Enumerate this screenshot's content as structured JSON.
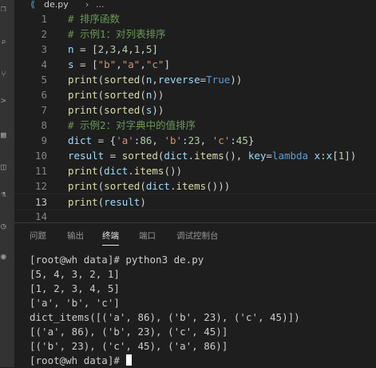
{
  "breadcrumb": {
    "file_icon": "python-file-icon",
    "file_name": "de.py",
    "separator": "›",
    "more": "..."
  },
  "editor": {
    "lines": [
      {
        "number": "1",
        "tokens": [
          {
            "t": "# 排序函数",
            "c": "comment"
          }
        ]
      },
      {
        "number": "2",
        "tokens": [
          {
            "t": "# 示例1：对列表排序",
            "c": "comment"
          }
        ]
      },
      {
        "number": "3",
        "tokens": [
          {
            "t": "n",
            "c": "var"
          },
          {
            "t": " = [",
            "c": "plain"
          },
          {
            "t": "2",
            "c": "number"
          },
          {
            "t": ",",
            "c": "plain"
          },
          {
            "t": "3",
            "c": "number"
          },
          {
            "t": ",",
            "c": "plain"
          },
          {
            "t": "4",
            "c": "number"
          },
          {
            "t": ",",
            "c": "plain"
          },
          {
            "t": "1",
            "c": "number"
          },
          {
            "t": ",",
            "c": "plain"
          },
          {
            "t": "5",
            "c": "number"
          },
          {
            "t": "]",
            "c": "plain"
          }
        ]
      },
      {
        "number": "4",
        "tokens": [
          {
            "t": "s",
            "c": "var"
          },
          {
            "t": " = [",
            "c": "plain"
          },
          {
            "t": "\"b\"",
            "c": "string"
          },
          {
            "t": ",",
            "c": "plain"
          },
          {
            "t": "\"a\"",
            "c": "string"
          },
          {
            "t": ",",
            "c": "plain"
          },
          {
            "t": "\"c\"",
            "c": "string"
          },
          {
            "t": "]",
            "c": "plain"
          }
        ]
      },
      {
        "number": "5",
        "tokens": [
          {
            "t": "print",
            "c": "func"
          },
          {
            "t": "(",
            "c": "plain"
          },
          {
            "t": "sorted",
            "c": "func"
          },
          {
            "t": "(",
            "c": "plain"
          },
          {
            "t": "n",
            "c": "var"
          },
          {
            "t": ",",
            "c": "plain"
          },
          {
            "t": "reverse",
            "c": "var"
          },
          {
            "t": "=",
            "c": "plain"
          },
          {
            "t": "True",
            "c": "kw"
          },
          {
            "t": "))",
            "c": "plain"
          }
        ]
      },
      {
        "number": "6",
        "tokens": [
          {
            "t": "print",
            "c": "func"
          },
          {
            "t": "(",
            "c": "plain"
          },
          {
            "t": "sorted",
            "c": "func"
          },
          {
            "t": "(",
            "c": "plain"
          },
          {
            "t": "n",
            "c": "var"
          },
          {
            "t": "))",
            "c": "plain"
          }
        ]
      },
      {
        "number": "7",
        "tokens": [
          {
            "t": "print",
            "c": "func"
          },
          {
            "t": "(",
            "c": "plain"
          },
          {
            "t": "sorted",
            "c": "func"
          },
          {
            "t": "(",
            "c": "plain"
          },
          {
            "t": "s",
            "c": "var"
          },
          {
            "t": "))",
            "c": "plain"
          }
        ]
      },
      {
        "number": "8",
        "tokens": [
          {
            "t": "# 示例2：对字典中的值排序",
            "c": "comment"
          }
        ]
      },
      {
        "number": "9",
        "tokens": [
          {
            "t": "dict",
            "c": "var"
          },
          {
            "t": " = {",
            "c": "plain"
          },
          {
            "t": "'a'",
            "c": "string"
          },
          {
            "t": ":",
            "c": "plain"
          },
          {
            "t": "86",
            "c": "number"
          },
          {
            "t": ", ",
            "c": "plain"
          },
          {
            "t": "'b'",
            "c": "string"
          },
          {
            "t": ":",
            "c": "plain"
          },
          {
            "t": "23",
            "c": "number"
          },
          {
            "t": ", ",
            "c": "plain"
          },
          {
            "t": "'c'",
            "c": "string"
          },
          {
            "t": ":",
            "c": "plain"
          },
          {
            "t": "45",
            "c": "number"
          },
          {
            "t": "}",
            "c": "plain"
          }
        ]
      },
      {
        "number": "10",
        "tokens": [
          {
            "t": "result",
            "c": "var"
          },
          {
            "t": " = ",
            "c": "plain"
          },
          {
            "t": "sorted",
            "c": "func"
          },
          {
            "t": "(",
            "c": "plain"
          },
          {
            "t": "dict",
            "c": "var"
          },
          {
            "t": ".",
            "c": "plain"
          },
          {
            "t": "items",
            "c": "func"
          },
          {
            "t": "(), ",
            "c": "plain"
          },
          {
            "t": "key",
            "c": "var"
          },
          {
            "t": "=",
            "c": "plain"
          },
          {
            "t": "lambda",
            "c": "kw"
          },
          {
            "t": " ",
            "c": "plain"
          },
          {
            "t": "x",
            "c": "var"
          },
          {
            "t": ":",
            "c": "plain"
          },
          {
            "t": "x",
            "c": "var"
          },
          {
            "t": "[",
            "c": "plain"
          },
          {
            "t": "1",
            "c": "number"
          },
          {
            "t": "])",
            "c": "plain"
          }
        ]
      },
      {
        "number": "11",
        "tokens": [
          {
            "t": "print",
            "c": "func"
          },
          {
            "t": "(",
            "c": "plain"
          },
          {
            "t": "dict",
            "c": "var"
          },
          {
            "t": ".",
            "c": "plain"
          },
          {
            "t": "items",
            "c": "func"
          },
          {
            "t": "())",
            "c": "plain"
          }
        ]
      },
      {
        "number": "12",
        "tokens": [
          {
            "t": "print",
            "c": "func"
          },
          {
            "t": "(",
            "c": "plain"
          },
          {
            "t": "sorted",
            "c": "func"
          },
          {
            "t": "(",
            "c": "plain"
          },
          {
            "t": "dict",
            "c": "var"
          },
          {
            "t": ".",
            "c": "plain"
          },
          {
            "t": "items",
            "c": "func"
          },
          {
            "t": "()))",
            "c": "plain"
          }
        ]
      },
      {
        "number": "13",
        "current": true,
        "tokens": [
          {
            "t": "print",
            "c": "func"
          },
          {
            "t": "(",
            "c": "plain"
          },
          {
            "t": "result",
            "c": "var"
          },
          {
            "t": ")",
            "c": "plain"
          }
        ]
      },
      {
        "number": "14",
        "tokens": []
      }
    ]
  },
  "panel": {
    "tabs": [
      {
        "label": "问题",
        "active": false
      },
      {
        "label": "输出",
        "active": false
      },
      {
        "label": "终端",
        "active": true
      },
      {
        "label": "端口",
        "active": false
      },
      {
        "label": "调试控制台",
        "active": false
      }
    ]
  },
  "terminal": {
    "lines": [
      "[root@wh data]# python3 de.py",
      "[5, 4, 3, 2, 1]",
      "[1, 2, 3, 4, 5]",
      "['a', 'b', 'c']",
      "dict_items([('a', 86), ('b', 23), ('c', 45)])",
      "[('a', 86), ('b', 23), ('c', 45)]",
      "[('b', 23), ('c', 45), ('a', 86)]"
    ],
    "prompt": "[root@wh data]# "
  },
  "activity_bar": {
    "icons": [
      "files-icon",
      "search-icon",
      "source-control-icon",
      "run-debug-icon",
      "extensions-icon",
      "remote-icon",
      "testing-icon",
      "docker-icon",
      "more-icon"
    ]
  }
}
